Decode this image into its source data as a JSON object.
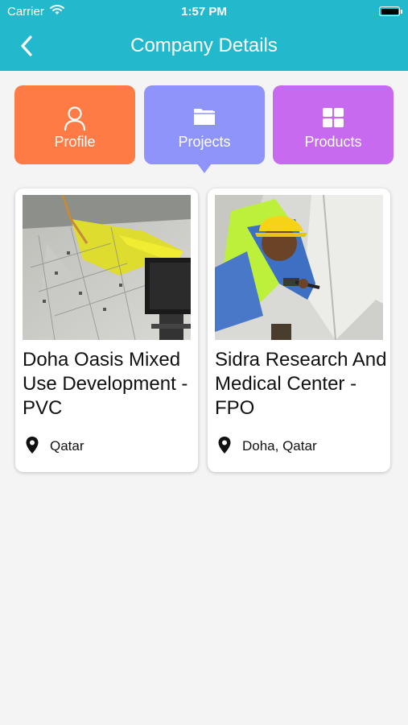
{
  "status_bar": {
    "carrier": "Carrier",
    "time": "1:57 PM"
  },
  "header": {
    "title": "Company Details"
  },
  "tabs": [
    {
      "label": "Profile",
      "icon": "person-icon",
      "color": "#ff7b45"
    },
    {
      "label": "Projects",
      "icon": "folder-icon",
      "color": "#8f94fb",
      "selected": true
    },
    {
      "label": "Products",
      "icon": "grid-icon",
      "color": "#c86af0"
    }
  ],
  "projects": [
    {
      "title": "Doha Oasis Mixed Use Development - PVC",
      "location": "Qatar",
      "image": "construction-site-photo"
    },
    {
      "title": "Sidra Research And Medical Center - FPO",
      "location": "Doha, Qatar",
      "image": "worker-installing-membrane-photo"
    }
  ],
  "colors": {
    "accent": "#22b9cc",
    "background": "#f4f4f4"
  }
}
